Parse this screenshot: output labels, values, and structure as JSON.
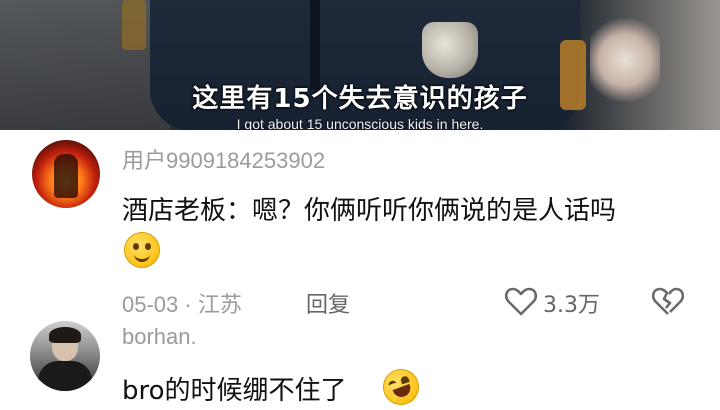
{
  "video": {
    "subtitle_cn": "这里有15个失去意识的孩子",
    "subtitle_en": "I got about 15 unconscious kids in here."
  },
  "comments": [
    {
      "username": "用户9909184253902",
      "text": "酒店老板：嗯？你俩听听你俩说的是人话吗",
      "emoji": "smile-emoji",
      "date": "05-03",
      "location": "江苏",
      "reply_label": "回复",
      "like_count": "3.3万"
    },
    {
      "username": "borhan.",
      "text": "bro的时候绷不住了",
      "emoji": "rolling-laughing-emoji"
    }
  ],
  "icons": {
    "like": "heart-icon",
    "dislike": "broken-heart-icon"
  },
  "colors": {
    "username": "#9b9b9b",
    "text": "#111111",
    "meta": "#9b9b9b"
  }
}
